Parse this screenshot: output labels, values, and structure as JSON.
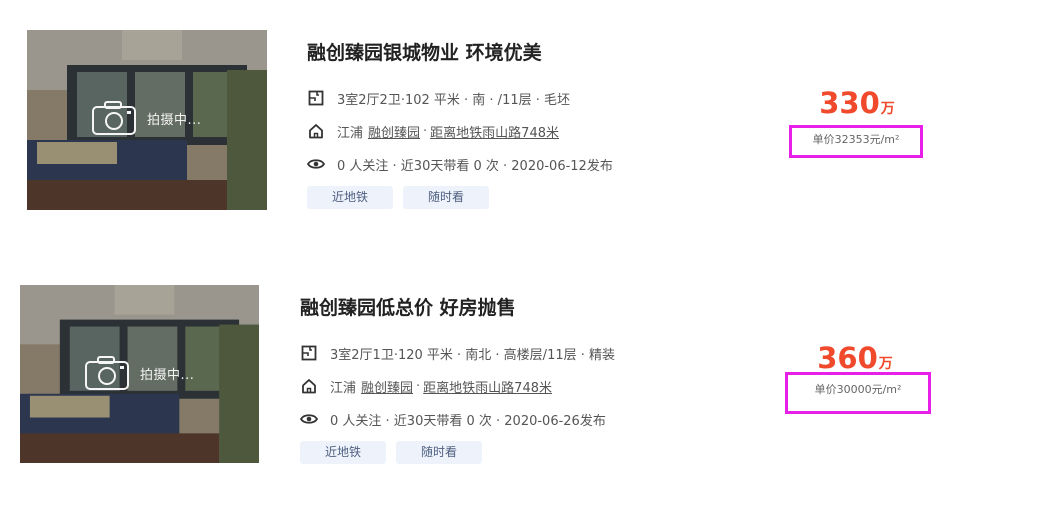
{
  "listings": [
    {
      "title": "融创臻园银城物业 环境优美",
      "photo_caption": "拍摄中...",
      "layout": "3室2厅2卫·102 平米 · 南 · /11层 · 毛坯",
      "district": "江浦",
      "community": "融创臻园",
      "metro": "距离地铁雨山路748米",
      "follow": "0 人关注 · 近30天带看 0 次 · 2020-06-12发布",
      "tags": [
        "近地铁",
        "随时看"
      ],
      "price": "330",
      "price_unit": "万",
      "unit_price": "单价32353元/m²"
    },
    {
      "title": "融创臻园低总价 好房抛售",
      "photo_caption": "拍摄中...",
      "layout": "3室2厅1卫·120 平米 · 南北 · 高楼层/11层 · 精装",
      "district": "江浦",
      "community": "融创臻园",
      "metro": "距离地铁雨山路748米",
      "follow": "0 人关注 · 近30天带看 0 次 · 2020-06-26发布",
      "tags": [
        "近地铁",
        "随时看"
      ],
      "price": "360",
      "price_unit": "万",
      "unit_price": "单价30000元/m²"
    }
  ],
  "icons": {
    "layout": "floorplan-icon",
    "location": "house-icon",
    "follow": "eye-icon",
    "photo": "camera-icon"
  },
  "colors": {
    "price": "#f0492c",
    "highlight_box": "#e620e6",
    "tag_bg": "#eef3fb"
  }
}
